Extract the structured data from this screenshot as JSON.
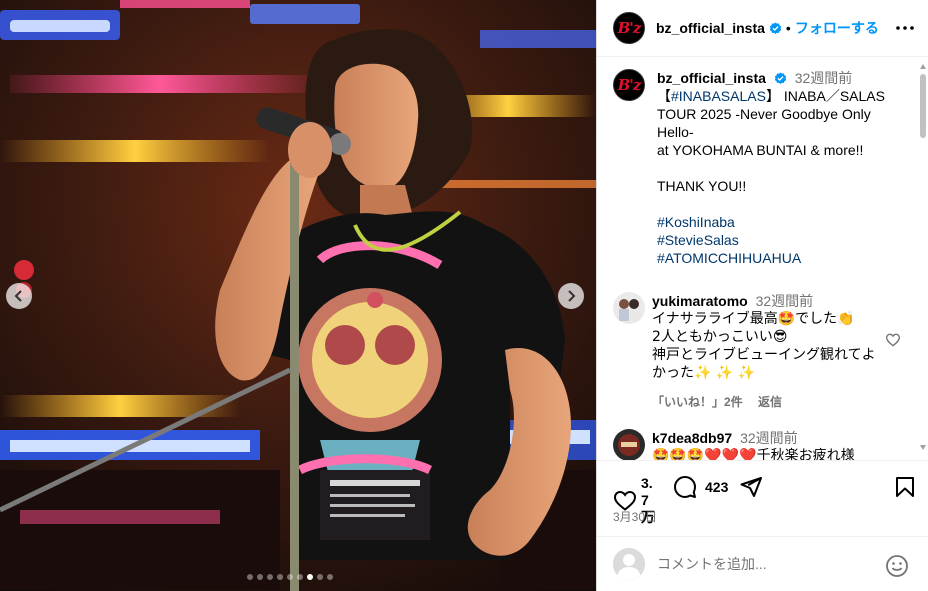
{
  "post": {
    "username": "bz_official_insta",
    "avatar_text": "B'z",
    "follow_label": "フォローする",
    "separator": "•",
    "caption_time": "32週間前",
    "caption_lines": [
      {
        "text": "【",
        "tag": "#INABASALAS",
        "after": "】 INABA／SALAS"
      },
      {
        "text": "TOUR 2025 -Never Goodbye Only"
      },
      {
        "text": "Hello-"
      },
      {
        "text": "at YOKOHAMA BUNTAI & more!!"
      },
      {
        "text": ""
      },
      {
        "text": "THANK YOU!!"
      },
      {
        "text": ""
      }
    ],
    "hashtags": [
      "#KoshiInaba",
      "#StevieSalas",
      "#ATOMICCHIHUAHUA"
    ],
    "likes": "3.7万",
    "comments_count": "423",
    "date": "3月30日"
  },
  "comments": [
    {
      "username": "yukimaratomo",
      "time": "32週間前",
      "lines": [
        "イナサラライブ最高🤩でした👏",
        "2人ともかっこいい😎",
        "神戸とライブビューイング観れてよ",
        "かった✨ ✨ ✨"
      ],
      "likes_label": "「いいね！」2件",
      "reply_label": "返信"
    },
    {
      "username": "k7dea8db97",
      "time": "32週間前",
      "lines": [
        "🤩🤩🤩❤️❤️❤️千秋楽お疲れ様"
      ]
    }
  ],
  "add_comment": {
    "placeholder": "コメントを追加..."
  },
  "carousel": {
    "total": 9,
    "active_index": 6
  },
  "colors": {
    "link": "#0095f6",
    "hashtag": "#00376b",
    "secondary": "#737373",
    "verified": "#0095f6",
    "logo_red": "#e0102d"
  }
}
